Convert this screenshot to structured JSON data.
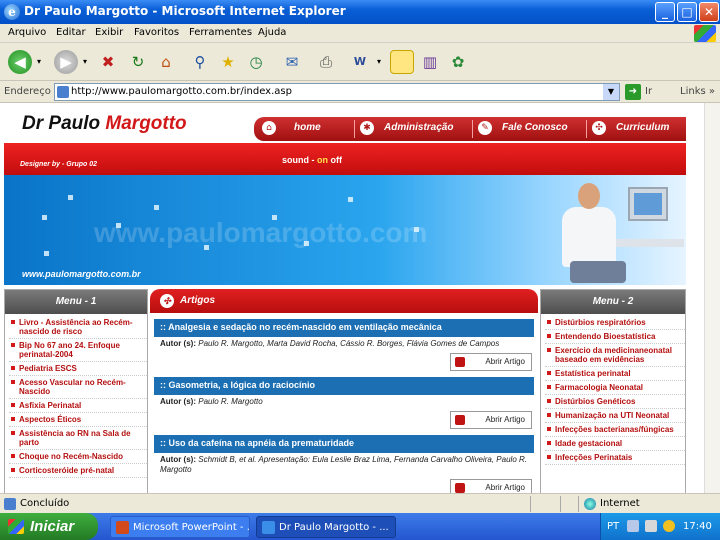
{
  "window": {
    "title": "Dr Paulo Margotto - Microsoft Internet Explorer",
    "minimize": "_",
    "maximize": "□",
    "close": "✕"
  },
  "menubar": [
    "Arquivo",
    "Editar",
    "Exibir",
    "Favoritos",
    "Ferramentes",
    "Ajuda"
  ],
  "toolbar": {
    "icons": [
      "back-icon",
      "forward-icon",
      "stop-icon",
      "refresh-icon",
      "home-icon",
      "search-icon",
      "favorites-icon",
      "history-icon",
      "mail-icon",
      "print-icon",
      "edit-icon",
      "note-icon",
      "media-icon",
      "messenger-icon"
    ]
  },
  "address": {
    "label": "Endereço",
    "url": "http://www.paulomargotto.com.br/index.asp",
    "go_label": "Ir",
    "links_label": "Links",
    "chevron": "»"
  },
  "site": {
    "brand_black": "Dr Paulo ",
    "brand_red": "Margotto",
    "nav": [
      "home",
      "Administração",
      "Fale Conosco",
      "Curriculum"
    ],
    "designer": "Designer by - Grupo 02",
    "sound_label": "sound - ",
    "sound_on": "on",
    "sound_off": "off",
    "banner_url": "www.paulomargotto.com.br",
    "watermark": "www.paulomargotto.com"
  },
  "left_menu": {
    "title": "Menu - 1",
    "items": [
      "Livro - Assistência ao Recém-nascido de risco",
      "Bip No 67 ano 24. Enfoque perinatal-2004",
      "Pediatria ESCS",
      "Acesso Vascular no Recém-Nascido",
      "Asfixia Perinatal",
      "Aspectos Éticos",
      "Assistência ao RN na Sala de parto",
      "Choque no Recém-Nascido",
      "Corticosteróide pré-natal"
    ]
  },
  "articles": {
    "title": "Artigos",
    "open_label": "Abrir Artigo",
    "author_label": "Autor (s):",
    "items": [
      {
        "title": ":: Analgesia e sedação no recém-nascido em ventilação mecânica",
        "authors": "Paulo R. Margotto, Marta David Rocha, Cássio R. Borges, Flávia Gomes de Campos"
      },
      {
        "title": ":: Gasometria, a lógica do raciocínio",
        "authors": "Paulo R. Margotto"
      },
      {
        "title": ":: Uso da cafeína na apnéia da prematuridade",
        "authors": "Schmidt B, et al. Apresentação: Eula Leslie Braz Lima, Fernanda Carvalho Oliveira, Paulo R. Margotto"
      }
    ]
  },
  "right_menu": {
    "title": "Menu - 2",
    "items": [
      "Distúrbios respiratórios",
      "Entendendo Bioestatística",
      "Exercício da medicinaneonatal baseado em evidências",
      "Estatística perinatal",
      "Farmacologia Neonatal",
      "Distúrbios Genéticos",
      "Humanização na UTI Neonatal",
      "Infecções bacterianas/fúngicas",
      "Idade gestacional",
      "Infecções Perinatais"
    ]
  },
  "statusbar": {
    "status": "Concluído",
    "zone": "Internet"
  },
  "taskbar": {
    "start": "Iniciar",
    "tasks": [
      "Microsoft PowerPoint - ...",
      "Dr Paulo Margotto - ..."
    ],
    "lang": "PT",
    "clock": "17:40"
  }
}
